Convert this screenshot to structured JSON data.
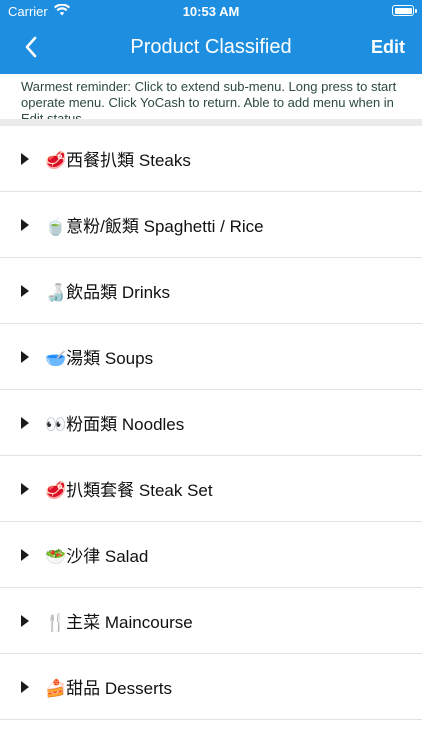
{
  "status_bar": {
    "carrier": "Carrier",
    "time": "10:53 AM",
    "wifi_icon": "wifi-icon",
    "battery_icon": "battery-icon"
  },
  "nav": {
    "back_icon": "chevron-left-icon",
    "title": "Product Classified",
    "edit_label": "Edit"
  },
  "reminder": "Warmest reminder: Click to extend sub-menu. Long press to start operate menu. Click YoCash to return. Able to add menu when in Edit status.",
  "categories": [
    {
      "label": "🥩西餐扒類 Steaks"
    },
    {
      "label": "🍵意粉/飯類 Spaghetti / Rice"
    },
    {
      "label": "🍶飲品類 Drinks"
    },
    {
      "label": "🥣湯類 Soups"
    },
    {
      "label": "👀粉面類 Noodles"
    },
    {
      "label": "🥩扒類套餐 Steak Set"
    },
    {
      "label": "🥗沙律 Salad"
    },
    {
      "label": "🍴主菜 Maincourse"
    },
    {
      "label": "🍰甜品 Desserts"
    }
  ],
  "colors": {
    "header_bg": "#1e8fe0",
    "reminder_text": "#2c4a3e"
  }
}
